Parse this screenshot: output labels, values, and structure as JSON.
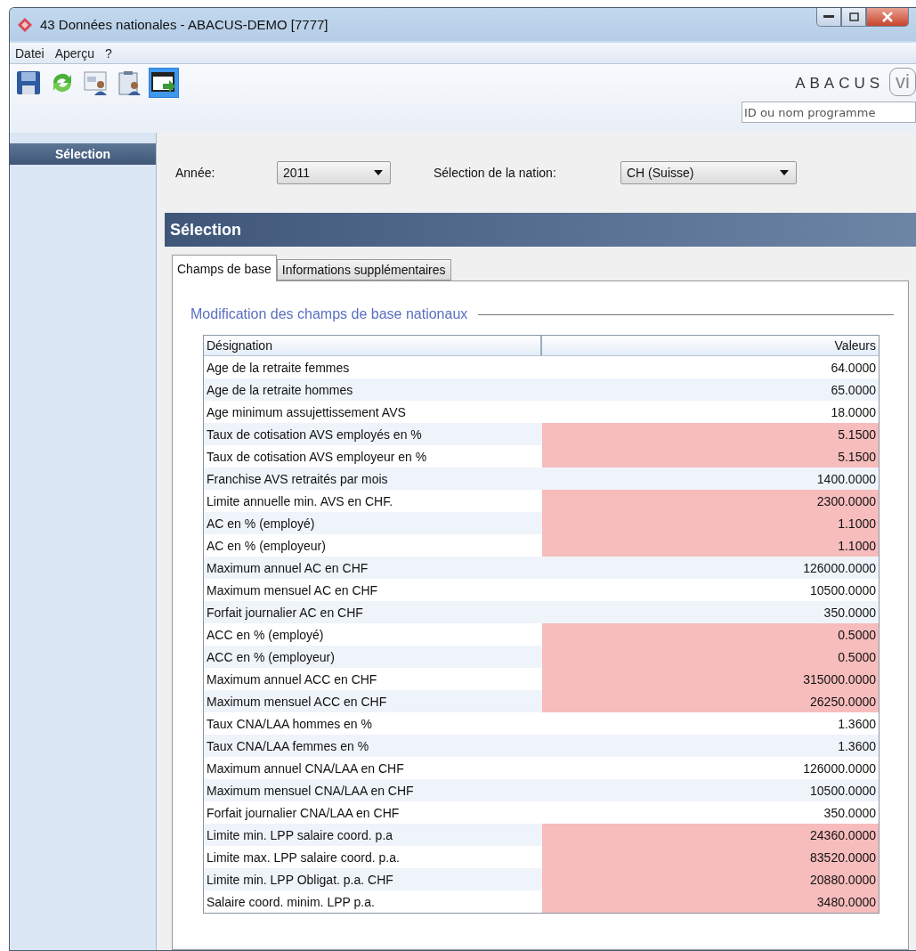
{
  "window": {
    "title": "43 Données nationales - ABACUS-DEMO [7777]"
  },
  "menu": [
    "Datei",
    "Aperçu",
    "?"
  ],
  "toolbar": [
    {
      "kind": "save",
      "selected": false
    },
    {
      "kind": "refresh",
      "selected": false
    },
    {
      "kind": "person-card",
      "selected": false
    },
    {
      "kind": "person-clipboard",
      "selected": false
    },
    {
      "kind": "window-arrow",
      "selected": true
    }
  ],
  "brand": {
    "name": "ABACUS",
    "badge": "vi"
  },
  "program_search": {
    "placeholder": "ID ou nom programme"
  },
  "sidebar": {
    "items": [
      {
        "label": "Sélection",
        "selected": true
      }
    ]
  },
  "filters": [
    {
      "label": "Année:",
      "value": "2011"
    },
    {
      "label": "Sélection de la nation:",
      "value": "CH (Suisse)"
    }
  ],
  "section_title": "Sélection",
  "tabs": [
    {
      "label": "Champs de base",
      "selected": true
    },
    {
      "label": "Informations supplémentaires",
      "selected": false
    }
  ],
  "group_title": "Modification des champs de base nationaux",
  "table": {
    "columns": [
      "Désignation",
      "Valeurs"
    ],
    "rows": [
      {
        "name": "Age de la retraite femmes",
        "value": "64.0000",
        "highlighted": false
      },
      {
        "name": "Age de la retraite hommes",
        "value": "65.0000",
        "highlighted": false
      },
      {
        "name": "Age minimum assujettissement AVS",
        "value": "18.0000",
        "highlighted": false
      },
      {
        "name": "Taux de cotisation AVS employés en %",
        "value": "5.1500",
        "highlighted": true
      },
      {
        "name": "Taux de cotisation AVS employeur en %",
        "value": "5.1500",
        "highlighted": true
      },
      {
        "name": "Franchise AVS retraités par mois",
        "value": "1400.0000",
        "highlighted": false
      },
      {
        "name": "Limite annuelle min. AVS en CHF.",
        "value": "2300.0000",
        "highlighted": true
      },
      {
        "name": "AC en % (employé)",
        "value": "1.1000",
        "highlighted": true
      },
      {
        "name": "AC en % (employeur)",
        "value": "1.1000",
        "highlighted": true
      },
      {
        "name": "Maximum annuel AC en CHF",
        "value": "126000.0000",
        "highlighted": false
      },
      {
        "name": "Maximum mensuel AC en CHF",
        "value": "10500.0000",
        "highlighted": false
      },
      {
        "name": "Forfait journalier AC en CHF",
        "value": "350.0000",
        "highlighted": false
      },
      {
        "name": "ACC en % (employé)",
        "value": "0.5000",
        "highlighted": true
      },
      {
        "name": "ACC en % (employeur)",
        "value": "0.5000",
        "highlighted": true
      },
      {
        "name": "Maximum annuel ACC en CHF",
        "value": "315000.0000",
        "highlighted": true
      },
      {
        "name": "Maximum mensuel ACC en CHF",
        "value": "26250.0000",
        "highlighted": true
      },
      {
        "name": "Taux CNA/LAA hommes en %",
        "value": "1.3600",
        "highlighted": false
      },
      {
        "name": "Taux CNA/LAA femmes en %",
        "value": "1.3600",
        "highlighted": false
      },
      {
        "name": "Maximum annuel CNA/LAA en CHF",
        "value": "126000.0000",
        "highlighted": false
      },
      {
        "name": "Maximum mensuel CNA/LAA en CHF",
        "value": "10500.0000",
        "highlighted": false
      },
      {
        "name": "Forfait journalier CNA/LAA en CHF",
        "value": "350.0000",
        "highlighted": false
      },
      {
        "name": "Limite min. LPP salaire coord. p.a",
        "value": "24360.0000",
        "highlighted": true
      },
      {
        "name": "Limite max. LPP salaire coord. p.a.",
        "value": "83520.0000",
        "highlighted": true
      },
      {
        "name": "Limite min. LPP Obligat. p.a. CHF",
        "value": "20880.0000",
        "highlighted": true
      },
      {
        "name": "Salaire coord. minim. LPP p.a.",
        "value": "3480.0000",
        "highlighted": true
      }
    ]
  }
}
